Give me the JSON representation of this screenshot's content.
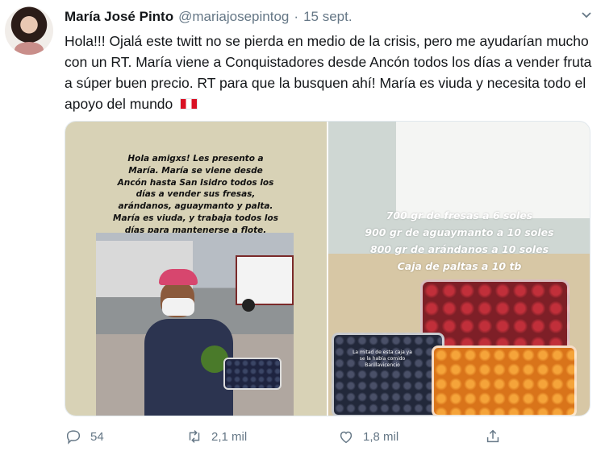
{
  "tweet": {
    "author_name": "María José Pinto",
    "handle": "@mariajosepintog",
    "separator": "·",
    "date": "15 sept.",
    "text": "Hola!!! Ojalá este twitt no se pierda en medio de la crisis, pero me ayudarían mucho con un RT. María viene a Conquistadores desde Ancón todos los días a vender fruta a súper buen precio. RT para que la busquen ahí! María es viuda y necesita todo el apoyo del mundo",
    "flag_icon": "peru-flag-icon"
  },
  "media": {
    "left_caption": "Hola amigxs! Les presento a\nMaría. María se viene desde\nAncón hasta San Isidro todos los\ndías a vender sus fresas,\narándanos, aguaymanto y palta.\nMaría es viuda, y trabaja todos los\ndías para mantenerse a flote.",
    "right_caption": "700 gr de fresas a 6 soles\n900 gr de aguaymanto a 10 soles\n800 gr de arándanos a 10 soles\nCaja de paltas a 10 tb",
    "right_small_note": "La mitad de esta caja ya\nse la había comido\nBarillavicencio"
  },
  "actions": {
    "reply_count": "54",
    "retweet_count": "2,1 mil",
    "like_count": "1,8 mil",
    "icons": [
      "reply-icon",
      "retweet-icon",
      "like-icon",
      "share-icon"
    ]
  },
  "colors": {
    "text": "#14171a",
    "secondary": "#657786",
    "border": "#e1e8ed"
  }
}
